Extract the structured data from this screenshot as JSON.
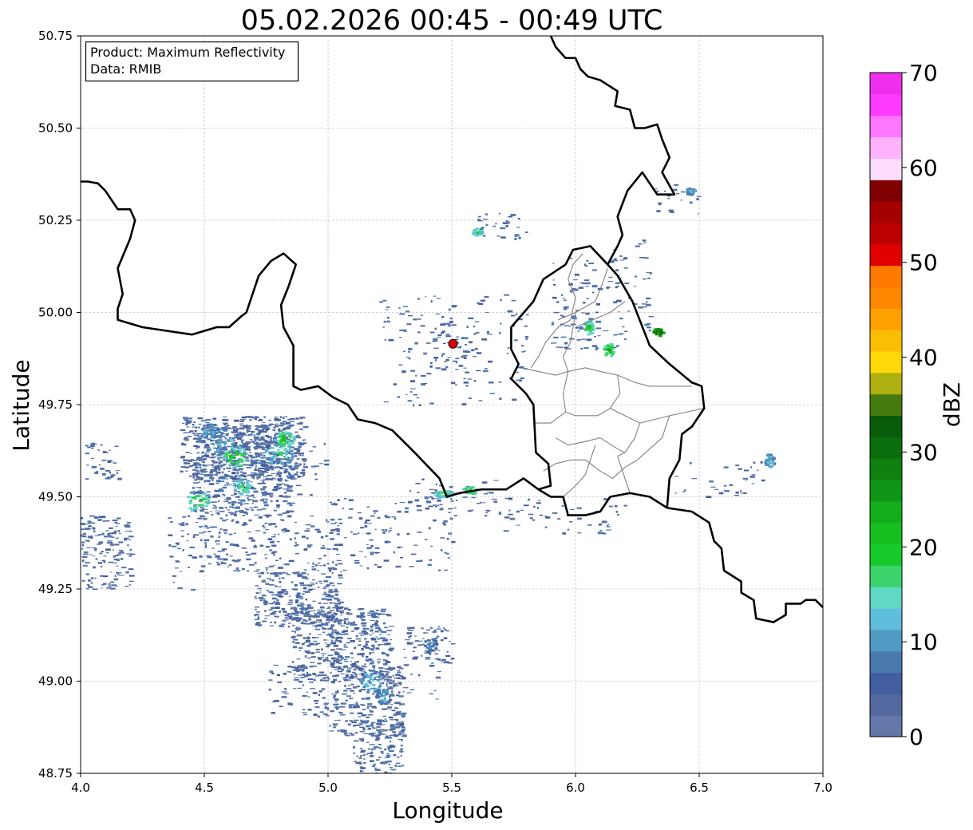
{
  "title": "05.02.2026 00:45 - 00:49 UTC",
  "info_box": {
    "product": "Product: Maximum Reflectivity",
    "data": "Data: RMIB"
  },
  "x_axis": {
    "label": "Longitude",
    "range": [
      4.0,
      7.0
    ],
    "ticks": [
      4.0,
      4.5,
      5.0,
      5.5,
      6.0,
      6.5,
      7.0
    ],
    "tick_labels": [
      "4.0",
      "4.5",
      "5.0",
      "5.5",
      "6.0",
      "6.5",
      "7.0"
    ]
  },
  "y_axis": {
    "label": "Latitude",
    "range": [
      48.75,
      50.75
    ],
    "ticks": [
      48.75,
      49.0,
      49.25,
      49.5,
      49.75,
      50.0,
      50.25,
      50.5,
      50.75
    ],
    "tick_labels": [
      "48.75",
      "49.00",
      "49.25",
      "49.50",
      "49.75",
      "50.00",
      "50.25",
      "50.50",
      "50.75"
    ]
  },
  "grid": true,
  "colorbar": {
    "label": "dBZ",
    "range": [
      0,
      70
    ],
    "ticks": [
      0,
      10,
      20,
      30,
      40,
      50,
      60,
      70
    ],
    "tick_labels": [
      "0",
      "10",
      "20",
      "30",
      "40",
      "50",
      "60",
      "70"
    ],
    "colors": [
      "#6477a8",
      "#53699e",
      "#425ea1",
      "#4a79ae",
      "#519ac3",
      "#5fbedb",
      "#5fd8c5",
      "#3dd36c",
      "#17cb2c",
      "#16be20",
      "#13ad1b",
      "#0f9616",
      "#0e8111",
      "#0b6e0d",
      "#075b09",
      "#457a0f",
      "#aeb012",
      "#fed808",
      "#fcbe05",
      "#fea000",
      "#fe8600",
      "#ff7a00",
      "#e10000",
      "#bc0000",
      "#a40000",
      "#7e0000",
      "#ffddff",
      "#ffb3ff",
      "#ff77ff",
      "#ff3aff",
      "#ee30ee"
    ]
  },
  "radar_site": {
    "lon": 5.505,
    "lat": 49.915,
    "color": "#e00000"
  },
  "borders": {
    "belgium_france": [
      [
        4.0,
        50.355
      ],
      [
        4.03,
        50.355
      ],
      [
        4.07,
        50.35
      ],
      [
        4.1,
        50.33
      ],
      [
        4.13,
        50.3
      ],
      [
        4.15,
        50.28
      ],
      [
        4.2,
        50.28
      ],
      [
        4.22,
        50.25
      ],
      [
        4.2,
        50.2
      ],
      [
        4.15,
        50.12
      ],
      [
        4.17,
        50.05
      ],
      [
        4.15,
        50.01
      ],
      [
        4.15,
        49.98
      ],
      [
        4.2,
        49.97
      ],
      [
        4.25,
        49.96
      ],
      [
        4.35,
        49.95
      ],
      [
        4.45,
        49.94
      ],
      [
        4.5,
        49.95
      ],
      [
        4.55,
        49.96
      ],
      [
        4.6,
        49.96
      ],
      [
        4.65,
        49.99
      ],
      [
        4.67,
        50.0
      ],
      [
        4.69,
        50.04
      ],
      [
        4.72,
        50.1
      ],
      [
        4.77,
        50.14
      ],
      [
        4.82,
        50.16
      ],
      [
        4.87,
        50.13
      ],
      [
        4.84,
        50.07
      ],
      [
        4.81,
        50.02
      ],
      [
        4.82,
        49.96
      ],
      [
        4.86,
        49.91
      ],
      [
        4.86,
        49.8
      ],
      [
        4.89,
        49.79
      ],
      [
        4.96,
        49.8
      ],
      [
        5.02,
        49.77
      ],
      [
        5.08,
        49.75
      ],
      [
        5.12,
        49.71
      ],
      [
        5.19,
        49.7
      ],
      [
        5.26,
        49.68
      ],
      [
        5.35,
        49.62
      ],
      [
        5.45,
        49.55
      ],
      [
        5.48,
        49.5
      ],
      [
        5.53,
        49.51
      ],
      [
        5.62,
        49.52
      ],
      [
        5.72,
        49.52
      ],
      [
        5.79,
        49.55
      ],
      [
        5.85,
        49.52
      ]
    ],
    "belgium_luxembourg": [
      [
        5.85,
        49.52
      ],
      [
        5.9,
        49.53
      ],
      [
        5.89,
        49.59
      ],
      [
        5.84,
        49.62
      ],
      [
        5.83,
        49.75
      ],
      [
        5.8,
        49.78
      ],
      [
        5.74,
        49.82
      ],
      [
        5.77,
        49.86
      ],
      [
        5.74,
        49.9
      ],
      [
        5.74,
        49.96
      ],
      [
        5.83,
        50.03
      ],
      [
        5.87,
        50.09
      ],
      [
        5.96,
        50.13
      ],
      [
        5.99,
        50.17
      ],
      [
        6.06,
        50.18
      ],
      [
        6.13,
        50.13
      ]
    ],
    "belgium_germany": [
      [
        6.13,
        50.13
      ],
      [
        6.17,
        50.18
      ],
      [
        6.19,
        50.21
      ],
      [
        6.17,
        50.26
      ],
      [
        6.21,
        50.33
      ],
      [
        6.27,
        50.38
      ],
      [
        6.33,
        50.32
      ],
      [
        6.4,
        50.32
      ],
      [
        6.35,
        50.38
      ],
      [
        6.38,
        50.42
      ],
      [
        6.35,
        50.47
      ],
      [
        6.33,
        50.51
      ],
      [
        6.28,
        50.5
      ],
      [
        6.24,
        50.5
      ],
      [
        6.22,
        50.55
      ],
      [
        6.16,
        50.56
      ],
      [
        6.17,
        50.6
      ],
      [
        6.1,
        50.63
      ],
      [
        6.05,
        50.64
      ],
      [
        6.02,
        50.66
      ],
      [
        6.0,
        50.69
      ],
      [
        5.96,
        50.69
      ],
      [
        5.92,
        50.72
      ],
      [
        5.9,
        50.75
      ]
    ],
    "luxembourg_germany": [
      [
        6.13,
        50.13
      ],
      [
        6.17,
        50.1
      ],
      [
        6.23,
        50.03
      ],
      [
        6.3,
        49.91
      ],
      [
        6.38,
        49.86
      ],
      [
        6.47,
        49.81
      ],
      [
        6.51,
        49.8
      ],
      [
        6.52,
        49.74
      ],
      [
        6.47,
        49.69
      ],
      [
        6.43,
        49.67
      ],
      [
        6.42,
        49.6
      ],
      [
        6.38,
        49.55
      ],
      [
        6.37,
        49.47
      ]
    ],
    "luxembourg_france": [
      [
        6.37,
        49.47
      ],
      [
        6.3,
        49.5
      ],
      [
        6.22,
        49.51
      ],
      [
        6.14,
        49.5
      ],
      [
        6.1,
        49.46
      ],
      [
        6.04,
        49.45
      ],
      [
        5.97,
        49.45
      ],
      [
        5.95,
        49.5
      ],
      [
        5.9,
        49.5
      ],
      [
        5.85,
        49.52
      ]
    ],
    "germany_france": [
      [
        6.37,
        49.47
      ],
      [
        6.47,
        49.46
      ],
      [
        6.54,
        49.43
      ],
      [
        6.56,
        49.38
      ],
      [
        6.59,
        49.36
      ],
      [
        6.6,
        49.3
      ],
      [
        6.67,
        49.27
      ],
      [
        6.67,
        49.24
      ],
      [
        6.72,
        49.22
      ],
      [
        6.73,
        49.17
      ],
      [
        6.8,
        49.16
      ],
      [
        6.85,
        49.18
      ],
      [
        6.85,
        49.21
      ],
      [
        6.91,
        49.21
      ],
      [
        6.93,
        49.22
      ],
      [
        6.97,
        49.22
      ],
      [
        7.0,
        49.2
      ]
    ]
  },
  "lux_cantons": [
    [
      [
        6.03,
        50.16
      ],
      [
        5.99,
        50.13
      ],
      [
        5.97,
        50.09
      ],
      [
        6.0,
        50.04
      ],
      [
        5.98,
        49.98
      ],
      [
        5.93,
        49.96
      ],
      [
        5.88,
        49.92
      ],
      [
        5.85,
        49.88
      ],
      [
        5.82,
        49.85
      ]
    ],
    [
      [
        6.13,
        50.12
      ],
      [
        6.11,
        50.08
      ],
      [
        6.08,
        50.03
      ],
      [
        6.0,
        50.0
      ],
      [
        5.93,
        49.98
      ]
    ],
    [
      [
        6.2,
        50.03
      ],
      [
        6.14,
        50.0
      ],
      [
        6.07,
        49.98
      ],
      [
        6.0,
        49.96
      ]
    ],
    [
      [
        6.0,
        50.0
      ],
      [
        5.98,
        49.92
      ],
      [
        5.95,
        49.88
      ],
      [
        5.97,
        49.84
      ]
    ],
    [
      [
        5.78,
        49.85
      ],
      [
        5.85,
        49.84
      ],
      [
        5.92,
        49.83
      ],
      [
        5.97,
        49.84
      ],
      [
        6.04,
        49.85
      ],
      [
        6.1,
        49.84
      ],
      [
        6.17,
        49.83
      ]
    ],
    [
      [
        5.97,
        49.84
      ],
      [
        5.95,
        49.78
      ],
      [
        5.96,
        49.73
      ],
      [
        5.9,
        49.7
      ],
      [
        5.83,
        49.7
      ]
    ],
    [
      [
        6.17,
        49.83
      ],
      [
        6.24,
        49.81
      ],
      [
        6.3,
        49.8
      ],
      [
        6.38,
        49.8
      ],
      [
        6.47,
        49.8
      ]
    ],
    [
      [
        6.17,
        49.83
      ],
      [
        6.18,
        49.78
      ],
      [
        6.14,
        49.74
      ],
      [
        6.09,
        49.72
      ],
      [
        6.0,
        49.72
      ],
      [
        5.96,
        49.73
      ]
    ],
    [
      [
        6.14,
        49.74
      ],
      [
        6.2,
        49.72
      ],
      [
        6.26,
        49.7
      ],
      [
        6.32,
        49.71
      ],
      [
        6.38,
        49.72
      ],
      [
        6.45,
        49.73
      ],
      [
        6.52,
        49.74
      ]
    ],
    [
      [
        6.26,
        49.7
      ],
      [
        6.24,
        49.66
      ],
      [
        6.2,
        49.62
      ],
      [
        6.17,
        49.61
      ]
    ],
    [
      [
        6.38,
        49.72
      ],
      [
        6.35,
        49.66
      ],
      [
        6.3,
        49.63
      ],
      [
        6.25,
        49.6
      ],
      [
        6.2,
        49.58
      ]
    ],
    [
      [
        5.92,
        49.66
      ],
      [
        5.97,
        49.64
      ],
      [
        6.04,
        49.65
      ],
      [
        6.1,
        49.66
      ],
      [
        6.17,
        49.63
      ],
      [
        6.2,
        49.62
      ]
    ],
    [
      [
        6.08,
        49.64
      ],
      [
        6.06,
        49.6
      ],
      [
        6.04,
        49.56
      ],
      [
        6.0,
        49.53
      ],
      [
        5.95,
        49.5
      ]
    ],
    [
      [
        5.87,
        49.57
      ],
      [
        5.92,
        49.59
      ],
      [
        5.98,
        49.6
      ],
      [
        6.04,
        49.6
      ],
      [
        6.1,
        49.57
      ],
      [
        6.15,
        49.55
      ],
      [
        6.2,
        49.58
      ]
    ],
    [
      [
        6.17,
        49.61
      ],
      [
        6.2,
        49.55
      ],
      [
        6.22,
        49.51
      ]
    ]
  ],
  "radar_patches": [
    [
      4.4,
      4.9,
      49.55,
      49.72,
      0.55
    ],
    [
      4.45,
      4.85,
      49.45,
      49.7,
      0.55
    ],
    [
      4.0,
      4.2,
      49.25,
      49.45,
      0.4
    ],
    [
      4.0,
      4.15,
      49.55,
      49.65,
      0.25
    ],
    [
      4.35,
      5.05,
      49.3,
      49.45,
      0.2
    ],
    [
      4.7,
      5.05,
      49.15,
      49.3,
      0.55
    ],
    [
      4.85,
      5.25,
      49.0,
      49.2,
      0.55
    ],
    [
      5.0,
      5.3,
      48.85,
      49.05,
      0.45
    ],
    [
      5.1,
      5.3,
      48.75,
      48.9,
      0.45
    ],
    [
      5.3,
      5.5,
      49.05,
      49.15,
      0.35
    ],
    [
      4.75,
      5.0,
      48.9,
      49.05,
      0.15
    ],
    [
      5.3,
      5.45,
      48.95,
      49.05,
      0.1
    ],
    [
      5.0,
      5.5,
      49.3,
      49.5,
      0.1
    ],
    [
      5.1,
      5.3,
      49.4,
      49.45,
      0.15
    ],
    [
      5.3,
      5.7,
      49.45,
      49.55,
      0.15
    ],
    [
      5.7,
      6.2,
      49.4,
      49.5,
      0.1
    ],
    [
      5.2,
      5.8,
      49.75,
      50.05,
      0.08
    ],
    [
      5.4,
      5.6,
      49.85,
      49.98,
      0.15
    ],
    [
      5.6,
      5.8,
      50.2,
      50.27,
      0.2
    ],
    [
      5.9,
      6.2,
      49.9,
      50.15,
      0.15
    ],
    [
      6.15,
      6.3,
      49.95,
      50.2,
      0.1
    ],
    [
      6.3,
      6.5,
      50.25,
      50.35,
      0.1
    ],
    [
      6.4,
      6.8,
      49.5,
      49.6,
      0.08
    ],
    [
      4.8,
      5.0,
      49.5,
      49.65,
      0.08
    ],
    [
      4.55,
      4.65,
      49.3,
      49.35,
      0.15
    ],
    [
      4.35,
      4.45,
      49.25,
      49.3,
      0.1
    ]
  ],
  "radar_hotspots": [
    [
      4.58,
      49.64,
      0.07,
      0.04,
      13
    ],
    [
      4.62,
      49.61,
      0.05,
      0.03,
      23
    ],
    [
      4.47,
      49.49,
      0.05,
      0.03,
      21
    ],
    [
      4.8,
      49.62,
      0.06,
      0.03,
      17
    ],
    [
      4.82,
      49.66,
      0.04,
      0.02,
      23
    ],
    [
      4.65,
      49.53,
      0.04,
      0.02,
      19
    ],
    [
      4.52,
      49.68,
      0.05,
      0.02,
      13
    ],
    [
      5.17,
      49.0,
      0.05,
      0.03,
      15
    ],
    [
      5.22,
      48.96,
      0.03,
      0.02,
      13
    ],
    [
      5.41,
      49.1,
      0.03,
      0.02,
      10
    ],
    [
      6.33,
      49.95,
      0.02,
      0.01,
      40
    ],
    [
      6.13,
      49.9,
      0.02,
      0.02,
      25
    ],
    [
      6.05,
      49.96,
      0.02,
      0.02,
      22
    ],
    [
      5.46,
      49.51,
      0.04,
      0.01,
      20
    ],
    [
      5.6,
      50.22,
      0.02,
      0.01,
      20
    ],
    [
      5.57,
      49.52,
      0.03,
      0.01,
      23
    ],
    [
      6.46,
      50.33,
      0.02,
      0.01,
      13
    ],
    [
      6.78,
      49.6,
      0.02,
      0.02,
      14
    ]
  ]
}
